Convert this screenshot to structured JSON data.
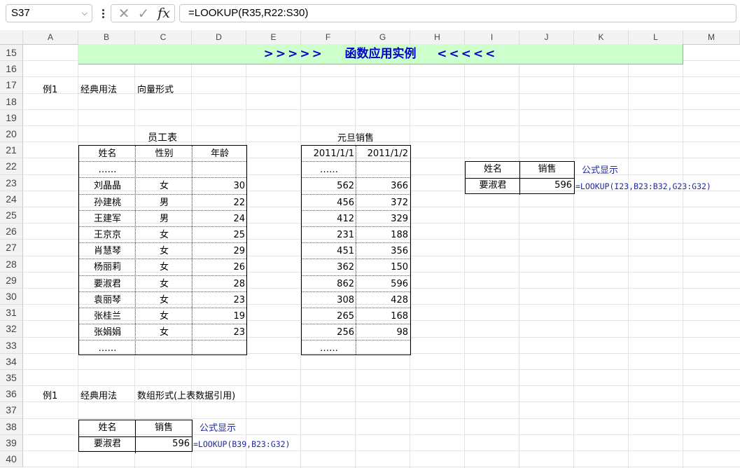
{
  "formula_bar": {
    "name_box": "S37",
    "formula": "=LOOKUP(R35,R22:S30)",
    "fx_label": "fx"
  },
  "columns": [
    "A",
    "B",
    "C",
    "D",
    "E",
    "F",
    "G",
    "H",
    "I",
    "J",
    "K",
    "L",
    "M"
  ],
  "rows": [
    "15",
    "16",
    "17",
    "18",
    "19",
    "20",
    "21",
    "22",
    "23",
    "24",
    "25",
    "26",
    "27",
    "28",
    "29",
    "30",
    "31",
    "32",
    "33",
    "34",
    "35",
    "36",
    "37",
    "38",
    "39",
    "40"
  ],
  "banner": {
    "left_arrows": ">>>>>",
    "title": "函数应用实例",
    "right_arrows": "<<<<<"
  },
  "section1": {
    "example": "例1",
    "method": "经典用法",
    "form": "向量形式"
  },
  "employee_table": {
    "title": "员工表",
    "headers": [
      "姓名",
      "性别",
      "年龄"
    ],
    "ellipsis": "……",
    "rows": [
      [
        "刘晶晶",
        "女",
        "30"
      ],
      [
        "孙建桃",
        "男",
        "22"
      ],
      [
        "王建军",
        "男",
        "24"
      ],
      [
        "王京京",
        "女",
        "25"
      ],
      [
        "肖慧琴",
        "女",
        "29"
      ],
      [
        "杨丽莉",
        "女",
        "26"
      ],
      [
        "要淑君",
        "女",
        "28"
      ],
      [
        "袁丽琴",
        "女",
        "23"
      ],
      [
        "张桂兰",
        "女",
        "19"
      ],
      [
        "张娟娟",
        "女",
        "23"
      ]
    ]
  },
  "sales_table": {
    "title": "元旦销售",
    "headers": [
      "2011/1/1",
      "2011/1/2"
    ],
    "ellipsis": "……",
    "rows": [
      [
        "562",
        "366"
      ],
      [
        "456",
        "372"
      ],
      [
        "412",
        "329"
      ],
      [
        "231",
        "188"
      ],
      [
        "451",
        "356"
      ],
      [
        "362",
        "150"
      ],
      [
        "862",
        "596"
      ],
      [
        "308",
        "428"
      ],
      [
        "265",
        "168"
      ],
      [
        "256",
        "98"
      ]
    ]
  },
  "lookup1": {
    "headers": [
      "姓名",
      "销售"
    ],
    "name": "要淑君",
    "value": "596",
    "label": "公式显示",
    "formula": "=LOOKUP(I23,B23:B32,G23:G32)"
  },
  "section2": {
    "example": "例1",
    "method": "经典用法",
    "form": "数组形式(上表数据引用)"
  },
  "lookup2": {
    "headers": [
      "姓名",
      "销售"
    ],
    "name": "要淑君",
    "value": "596",
    "label": "公式显示",
    "formula": "=LOOKUP(B39,B23:G32)"
  }
}
